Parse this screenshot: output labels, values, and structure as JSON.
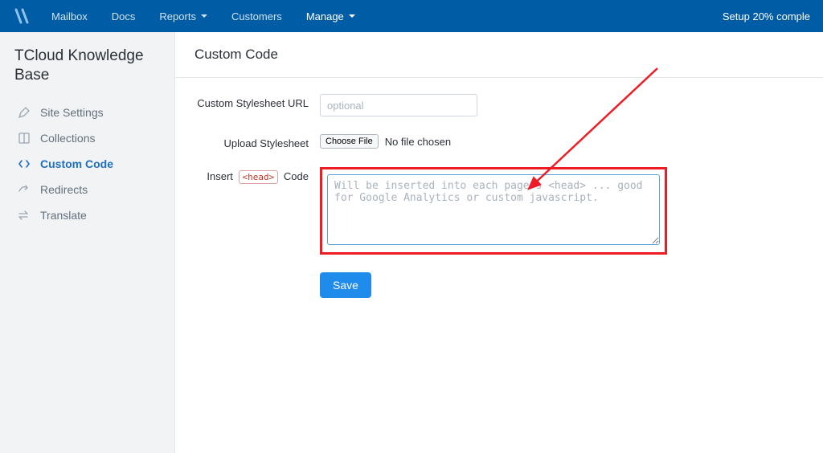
{
  "nav": {
    "items": [
      {
        "label": "Mailbox",
        "has_caret": false,
        "active": false
      },
      {
        "label": "Docs",
        "has_caret": false,
        "active": false
      },
      {
        "label": "Reports",
        "has_caret": true,
        "active": false
      },
      {
        "label": "Customers",
        "has_caret": false,
        "active": false
      },
      {
        "label": "Manage",
        "has_caret": true,
        "active": true
      }
    ],
    "setup_status": "Setup 20% comple"
  },
  "sidebar": {
    "site_title": "TCloud Knowledge Base",
    "items": [
      {
        "label": "Site Settings",
        "icon": "pencil-icon",
        "active": false
      },
      {
        "label": "Collections",
        "icon": "book-icon",
        "active": false
      },
      {
        "label": "Custom Code",
        "icon": "code-icon",
        "active": true
      },
      {
        "label": "Redirects",
        "icon": "redirect-icon",
        "active": false
      },
      {
        "label": "Translate",
        "icon": "swap-icon",
        "active": false
      }
    ]
  },
  "page": {
    "title": "Custom Code",
    "stylesheet_url": {
      "label": "Custom Stylesheet URL",
      "value": "",
      "placeholder": "optional"
    },
    "upload": {
      "label": "Upload Stylesheet",
      "button": "Choose File",
      "status": "No file chosen"
    },
    "insert_head": {
      "label_pre": "Insert",
      "label_tag": "<head>",
      "label_post": "Code",
      "value": "",
      "placeholder": "Will be inserted into each page's <head> ... good for Google Analytics or custom javascript."
    },
    "save": "Save"
  },
  "colors": {
    "primary_nav": "#005ca4",
    "accent": "#1f8ceb",
    "annotation": "#ee1c25"
  }
}
